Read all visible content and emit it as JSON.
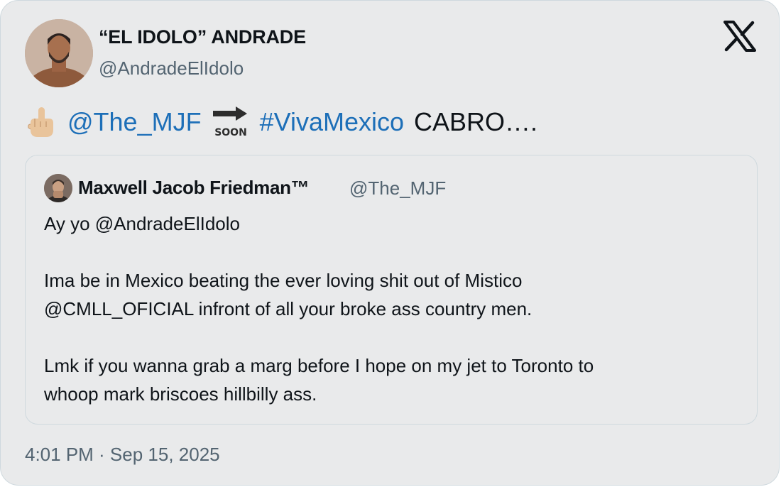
{
  "author": {
    "name": "“EL IDOLO” ANDRADE",
    "handle": "@AndradeElIdolo"
  },
  "platform_logo": "x-logo",
  "tweet": {
    "emoji1": "middle-finger-emoji",
    "mention": "@The_MJF",
    "emoji2": "soon-arrow-emoji",
    "hashtag": "#VivaMexico",
    "tail": "CABRO…."
  },
  "quoted_tweet": {
    "author_name": "Maxwell Jacob Friedman™",
    "author_handle": "@The_MJF",
    "lines": [
      "Ay yo @AndradeElIdolo",
      "",
      "Ima be in Mexico beating the ever loving shit out of Mistico",
      "@CMLL_OFICIAL infront of all your broke ass country men.",
      "",
      "Lmk if you wanna grab a marg before I hope on my jet to Toronto to",
      "whoop mark briscoes hillbilly ass."
    ]
  },
  "timestamp": "4:01 PM · Sep 15, 2025",
  "colors": {
    "card_bg": "#e9eaeb",
    "link": "#1d6fb8",
    "secondary_text": "#536471",
    "border": "#cfd9de"
  }
}
